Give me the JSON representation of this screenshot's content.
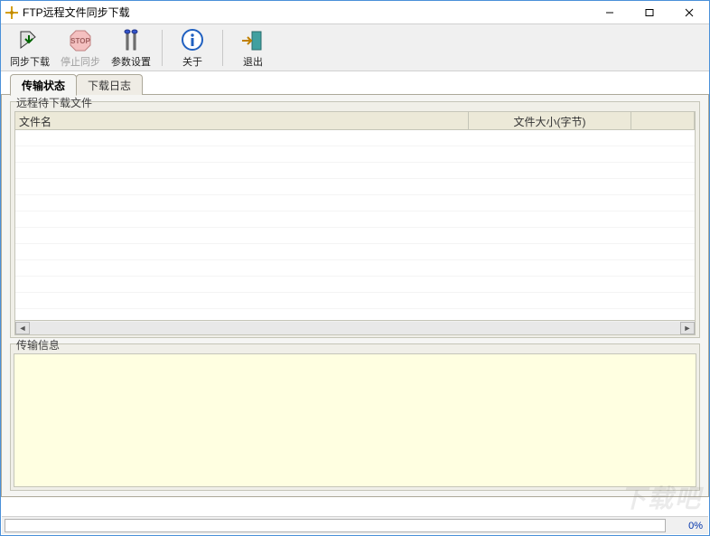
{
  "window": {
    "title": "FTP远程文件同步下载"
  },
  "toolbar": {
    "sync_label": "同步下载",
    "stop_label": "停止同步",
    "settings_label": "参数设置",
    "about_label": "关于",
    "exit_label": "退出"
  },
  "tabs": {
    "status": "传输状态",
    "log": "下载日志"
  },
  "list_panel": {
    "caption": "远程待下载文件",
    "col_filename": "文件名",
    "col_filesize": "文件大小(字节)"
  },
  "info_panel": {
    "caption": "传输信息"
  },
  "status": {
    "progress_pct": "0%"
  },
  "watermark": "下载吧"
}
